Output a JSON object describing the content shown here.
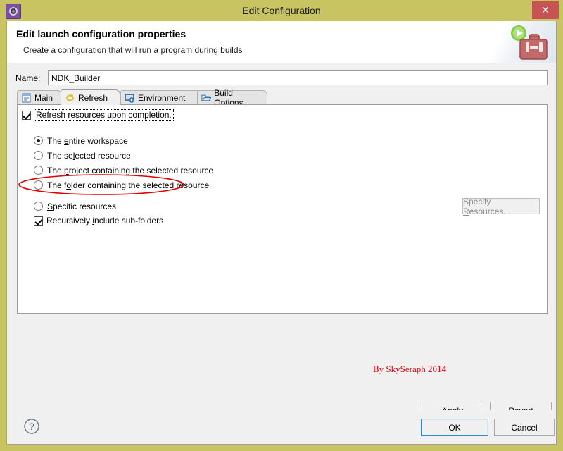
{
  "window": {
    "title": "Edit Configuration",
    "icon": "gear-icon",
    "close_label": "✕"
  },
  "banner": {
    "title": "Edit launch configuration properties",
    "subtitle": "Create a configuration that will run a program during builds",
    "icon": "toolbox-with-play-icon"
  },
  "form": {
    "name_label_pre": "N",
    "name_label_post": "ame:",
    "name_value": "NDK_Builder",
    "name_placeholder": ""
  },
  "tabs": [
    {
      "label": "Main",
      "icon": "document-icon",
      "active": false
    },
    {
      "label": "Refresh",
      "icon": "refresh-arrows-icon",
      "active": true
    },
    {
      "label": "Environment",
      "icon": "environment-icon",
      "active": false
    },
    {
      "label": "Build Options",
      "icon": "open-folder-icon",
      "active": false
    }
  ],
  "refresh_tab": {
    "enable_checkbox": {
      "label": "Refresh resources upon completion.",
      "checked": true
    },
    "scope_options": [
      {
        "label_pre": "The ",
        "mnemonic": "e",
        "label_post": "ntire workspace",
        "selected": true
      },
      {
        "label_pre": "The se",
        "mnemonic": "l",
        "label_post": "ected resource",
        "selected": false
      },
      {
        "label_pre": "The ",
        "mnemonic": "p",
        "label_post": "roject containing the selected resource",
        "selected": false
      },
      {
        "label_pre": "The f",
        "mnemonic": "o",
        "label_post": "lder containing the selected resource",
        "selected": false
      },
      {
        "label_pre": "",
        "mnemonic": "S",
        "label_post": "pecific resources",
        "selected": false
      }
    ],
    "recursive_checkbox": {
      "label_pre": "Recursively ",
      "mnemonic": "i",
      "label_post": "nclude sub-folders",
      "checked": true
    },
    "specify_button": {
      "label_pre": "Specify ",
      "mnemonic": "R",
      "label_post": "esources...",
      "enabled": false
    },
    "watermark": "By SkySeraph 2014"
  },
  "buttons": {
    "apply": {
      "pre": "Appl",
      "mnemonic": "y",
      "post": ""
    },
    "revert": {
      "pre": "Re",
      "mnemonic": "v",
      "post": "ert"
    },
    "ok": "OK",
    "cancel": "Cancel",
    "help": "?"
  },
  "colors": {
    "titlebar": "#c9c462",
    "close": "#c75454",
    "dialog": "#f0f0f0",
    "panel": "#ffffff",
    "watermark": "#e8000b",
    "annotation": "#e00000",
    "focus": "#2a8ad4"
  }
}
